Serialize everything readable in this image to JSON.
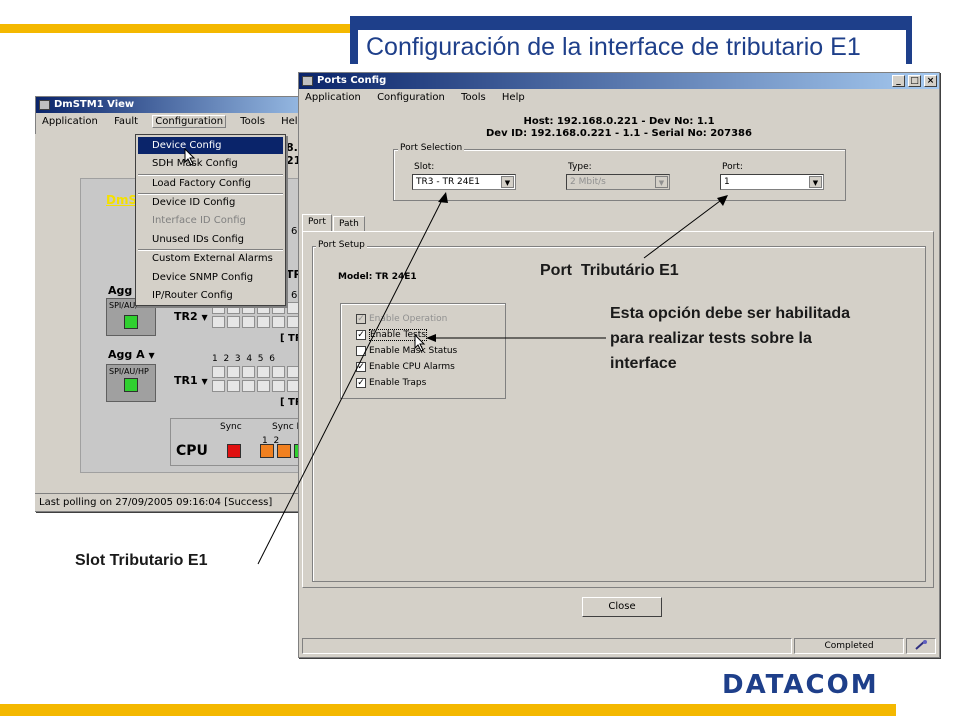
{
  "slide": {
    "title": "Configuración de la interface de tributario E1",
    "logo": "DATACOM",
    "annotations": {
      "port": "Port  Tributário E1",
      "option_line1": "Esta opción debe ser habilitada",
      "option_line2": "para realizar tests sobre la",
      "option_line3": "interface",
      "slot": "Slot Tributario E1"
    },
    "colors": {
      "accent_blue": "#1e3f8a",
      "accent_yellow": "#f4b800"
    }
  },
  "back_window": {
    "title": "DmSTM1 View",
    "menu": [
      "Application",
      "Fault",
      "Configuration",
      "Tools",
      "Help"
    ],
    "dropdown": [
      {
        "label": "Device Config",
        "state": "highlighted"
      },
      {
        "label": "SDH Mask Config",
        "state": "normal"
      },
      {
        "label": "Load Factory Config",
        "state": "normal"
      },
      {
        "label": "Device ID Config",
        "state": "normal"
      },
      {
        "label": "Interface ID Config",
        "state": "disabled"
      },
      {
        "label": "Unused IDs Config",
        "state": "normal"
      },
      {
        "label": "Custom External Alarms",
        "state": "normal"
      },
      {
        "label": "Device SNMP Config",
        "state": "normal"
      },
      {
        "label": "IP/Router Config",
        "state": "normal"
      }
    ],
    "frag_top1": "8.0",
    "frag_top2": "21",
    "panel_title_frag": "DmS",
    "agg_b_label": "Agg I",
    "agg_a_label": "Agg A",
    "spi_label": "SPI/AU/HP",
    "tr2_label": "TR2",
    "tr1_label": "TR1",
    "tr_bracket": "[ TR",
    "tr_frag_label": "TR",
    "port_nums": "1  2  3  4  5  6",
    "frag_6": "6",
    "cpu_label": "CPU",
    "sync_label": "Sync",
    "sync2_label": "Sync I",
    "sync_nums": "1  2",
    "status": "Last polling on 27/09/2005 09:16:04 [Success]"
  },
  "ports_window": {
    "title": "Ports Config",
    "menu": [
      "Application",
      "Configuration",
      "Tools",
      "Help"
    ],
    "host_line": "Host: 192.168.0.221 - Dev No: 1.1",
    "devid_line": "Dev ID: 192.168.0.221 - 1.1 - Serial No: 207386",
    "port_selection": {
      "title": "Port Selection",
      "slot_label": "Slot:",
      "slot_value": "TR3 - TR 24E1",
      "type_label": "Type:",
      "type_value": "2 Mbit/s",
      "port_label": "Port:",
      "port_value": "1"
    },
    "tabs": [
      "Port",
      "Path"
    ],
    "port_setup": {
      "title": "Port Setup",
      "model": "Model: TR 24E1",
      "options": [
        {
          "label": "Enable Operation",
          "checked": true,
          "disabled": true
        },
        {
          "label": "Enable Tests",
          "checked": true,
          "disabled": false
        },
        {
          "label": "Enable Mask Status",
          "checked": false,
          "disabled": false
        },
        {
          "label": "Enable CPU Alarms",
          "checked": true,
          "disabled": false
        },
        {
          "label": "Enable Traps",
          "checked": true,
          "disabled": false
        }
      ]
    },
    "close_button": "Close",
    "status": "Completed"
  }
}
